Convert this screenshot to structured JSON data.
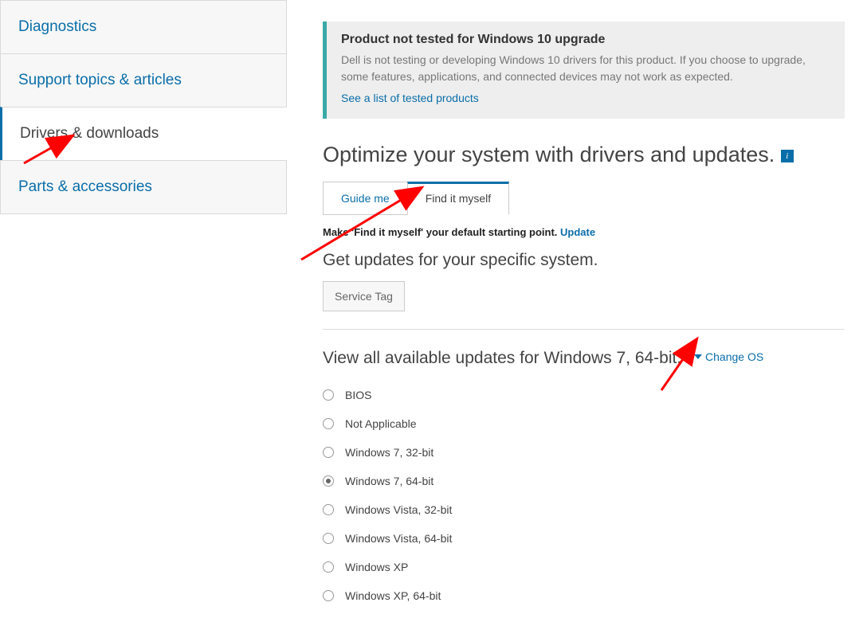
{
  "sidebar": {
    "items": [
      {
        "label": "Diagnostics"
      },
      {
        "label": "Support topics & articles"
      },
      {
        "label": "Drivers & downloads"
      },
      {
        "label": "Parts & accessories"
      }
    ]
  },
  "notice": {
    "title": "Product not tested for Windows 10 upgrade",
    "body": "Dell is not testing or developing Windows 10 drivers for this product. If you choose to upgrade, some features, applications, and connected devices may not work as expected.",
    "link": "See a list of tested products"
  },
  "headline": "Optimize your system with drivers and updates.",
  "info_icon": "i",
  "tabs": {
    "guide": "Guide me",
    "find": "Find it myself"
  },
  "default_note_prefix": "Make '",
  "default_note_mid": "Find it myself",
  "default_note_suffix": "' your default starting point. ",
  "update_link": "Update",
  "subhead": "Get updates for your specific system.",
  "service_tag": "Service Tag",
  "view_line": "View all available updates for Windows 7, 64-bit.",
  "change_os": "Change OS",
  "os_options": [
    {
      "label": "BIOS",
      "selected": false
    },
    {
      "label": "Not Applicable",
      "selected": false
    },
    {
      "label": "Windows 7, 32-bit",
      "selected": false
    },
    {
      "label": "Windows 7, 64-bit",
      "selected": true
    },
    {
      "label": "Windows Vista, 32-bit",
      "selected": false
    },
    {
      "label": "Windows Vista, 64-bit",
      "selected": false
    },
    {
      "label": "Windows XP",
      "selected": false
    },
    {
      "label": "Windows XP, 64-bit",
      "selected": false
    }
  ]
}
